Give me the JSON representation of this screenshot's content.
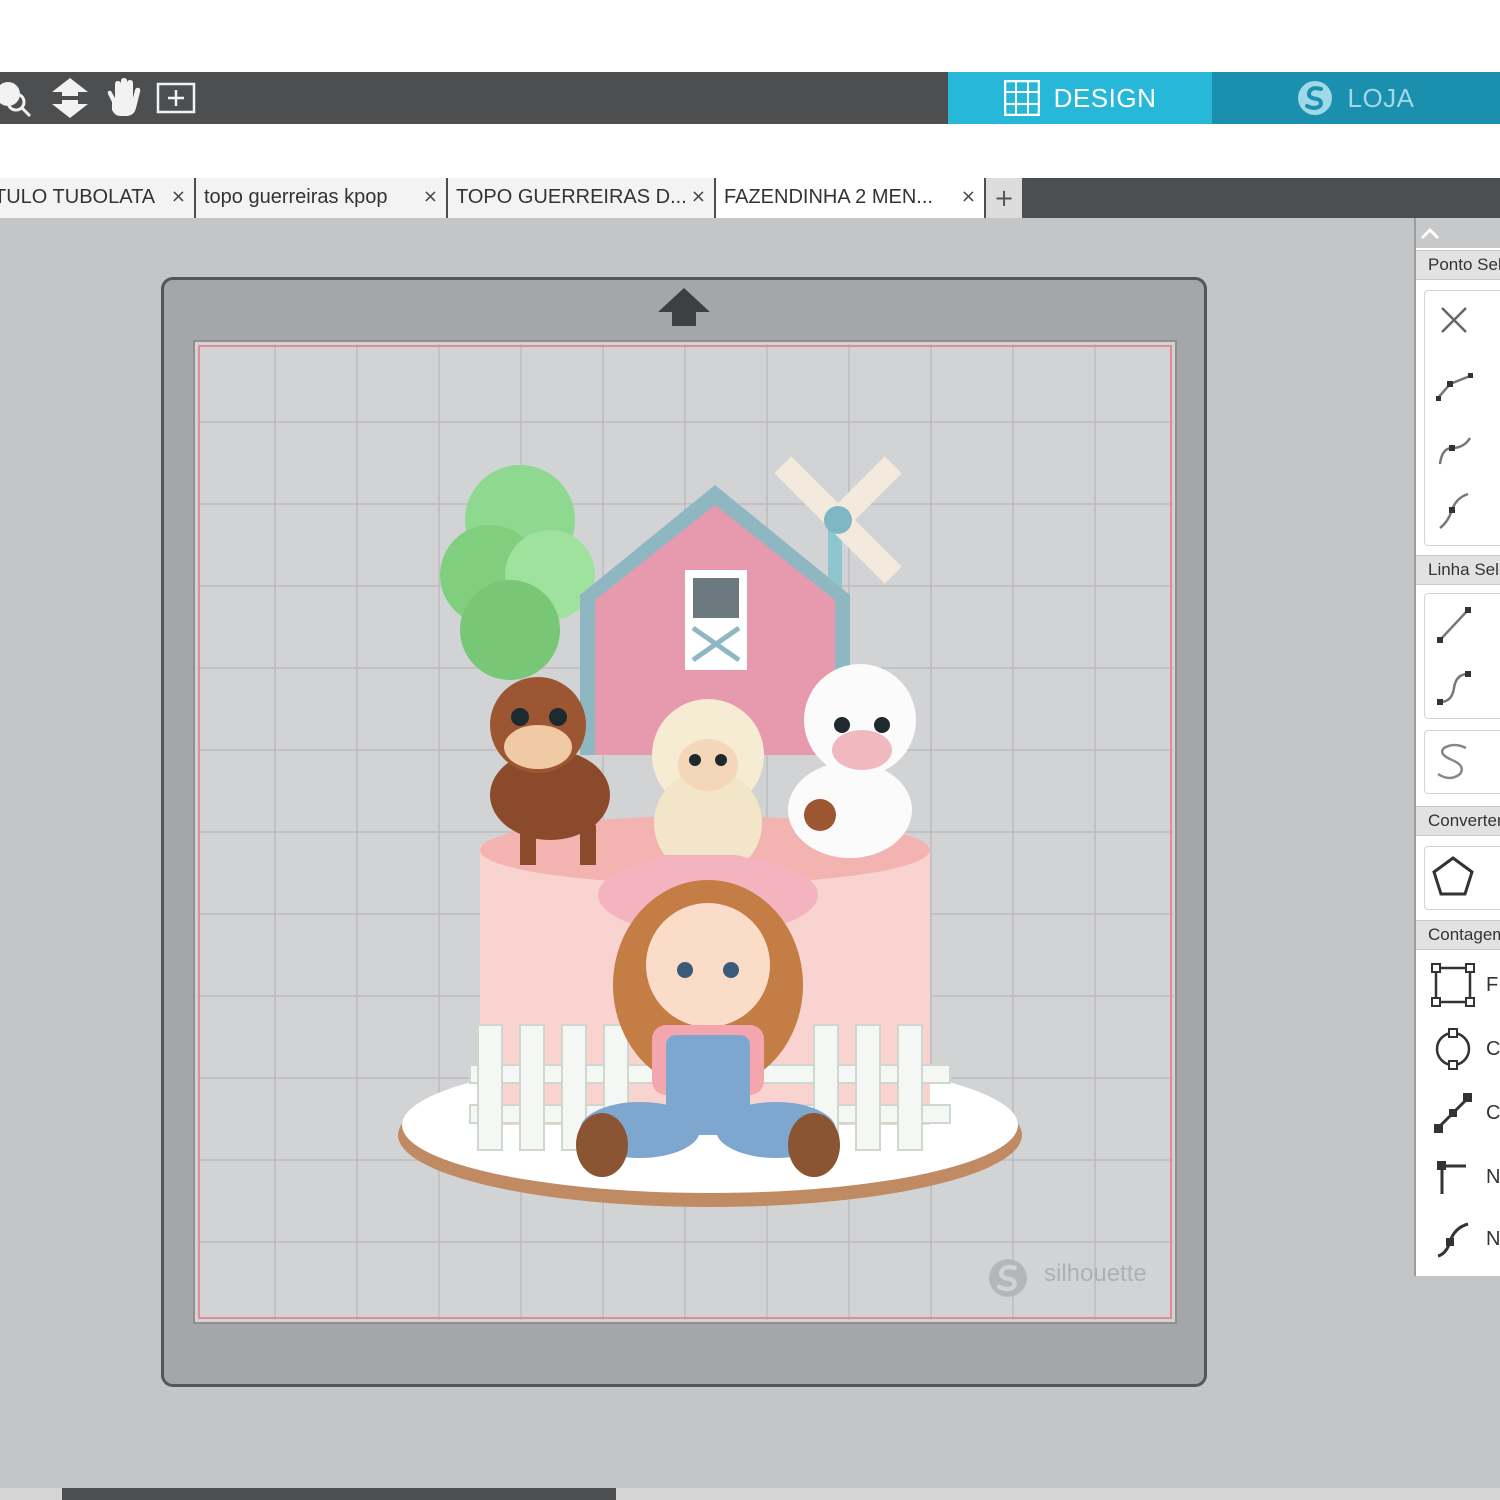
{
  "toolbar": {
    "tools": [
      "zoom-select-icon",
      "feed-down-icon",
      "pan-hand-icon",
      "fit-page-icon"
    ]
  },
  "modes": {
    "design": {
      "label": "DESIGN",
      "icon": "grid-icon",
      "color": "#27b7d9"
    },
    "store": {
      "label": "LOJA",
      "icon": "silhouette-logo-icon",
      "color": "#1b8fae"
    }
  },
  "tabs": [
    {
      "label": "TULO TUBOLATA",
      "close": "×"
    },
    {
      "label": "topo guerreiras kpop",
      "close": "×"
    },
    {
      "label": "TOPO GUERREIRAS D...",
      "close": "×"
    },
    {
      "label": "FAZENDINHA 2 MEN...",
      "close": "×"
    }
  ],
  "tab_add": "+",
  "canvas": {
    "watermark": "silhouette",
    "artwork": "farm-cake-topper-illustration"
  },
  "panel": {
    "sections": [
      {
        "title": "Ponto Sel"
      },
      {
        "title": "Linha Sel"
      },
      {
        "title": "Converter"
      },
      {
        "title": "Contagem"
      }
    ],
    "point_icons": [
      "delete-point-icon",
      "corner-point-icon",
      "smooth-point-icon",
      "symmetric-point-icon"
    ],
    "line_icons": [
      "straight-line-icon",
      "curve-line-icon"
    ],
    "misc_icons": [
      "s-curve-icon",
      "polygon-convert-icon"
    ],
    "contour_items": [
      {
        "icon": "bounding-box-icon",
        "letter": "F"
      },
      {
        "icon": "circle-node-icon",
        "letter": "C"
      },
      {
        "icon": "diagonal-line-icon",
        "letter": "C"
      },
      {
        "icon": "node-corner-icon",
        "letter": "N"
      },
      {
        "icon": "node-curve-icon",
        "letter": "N"
      }
    ]
  }
}
